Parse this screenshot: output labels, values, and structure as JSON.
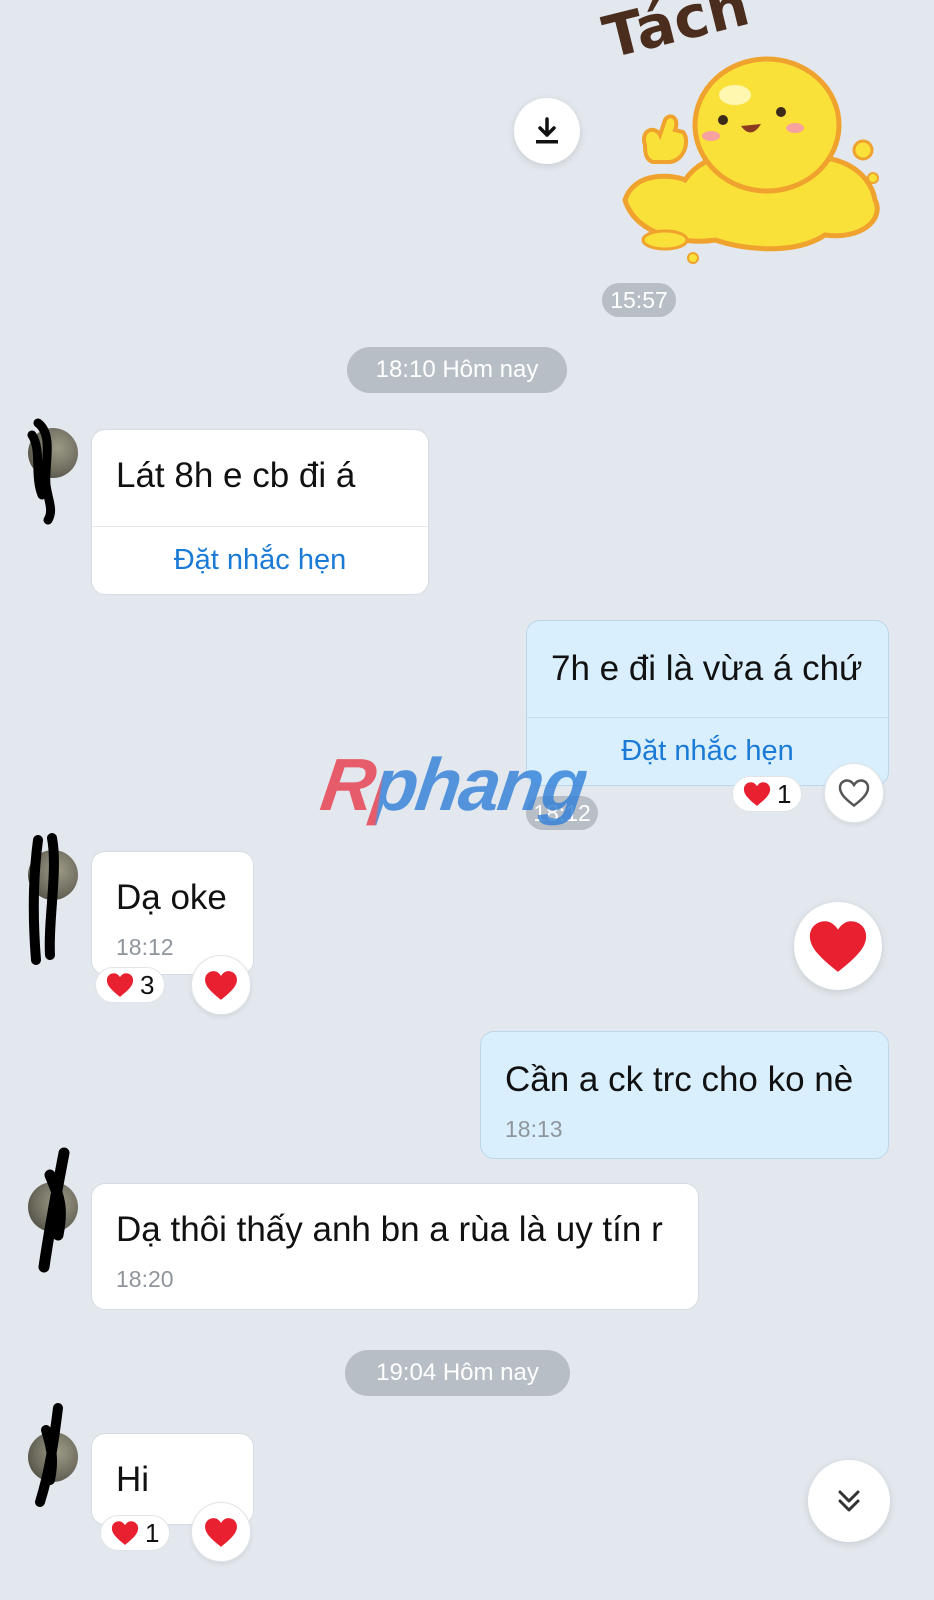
{
  "sticker": {
    "caption": "Tách",
    "time": "15:57"
  },
  "date_dividers": [
    "18:10 Hôm nay",
    "19:04 Hôm nay"
  ],
  "messages": [
    {
      "side": "left",
      "text": "Lát 8h e cb đi á",
      "action": "Đặt nhắc hẹn"
    },
    {
      "side": "right",
      "text": "7h e đi là vừa á chứ",
      "action": "Đặt nhắc hẹn",
      "time": "18:12",
      "reaction_count": "1"
    },
    {
      "side": "left",
      "text": "Dạ oke",
      "time": "18:12",
      "reaction_count": "3"
    },
    {
      "side": "right",
      "text": "Cần a ck trc cho ko nè",
      "time": "18:13"
    },
    {
      "side": "left",
      "text": "Dạ thôi thấy anh bn a rùa là uy tín r",
      "time": "18:20"
    },
    {
      "side": "left",
      "text": "Hi",
      "reaction_count": "1"
    }
  ],
  "watermark": "Rphang",
  "icons": {
    "download": "download-icon",
    "heart": "heart-icon",
    "heart_outline": "heart-outline-icon",
    "scroll_down": "double-chevron-down-icon"
  },
  "colors": {
    "background": "#e3e8ee",
    "mine_bubble": "#d9effd",
    "link": "#1a7ad6",
    "heart": "#e8202f"
  }
}
